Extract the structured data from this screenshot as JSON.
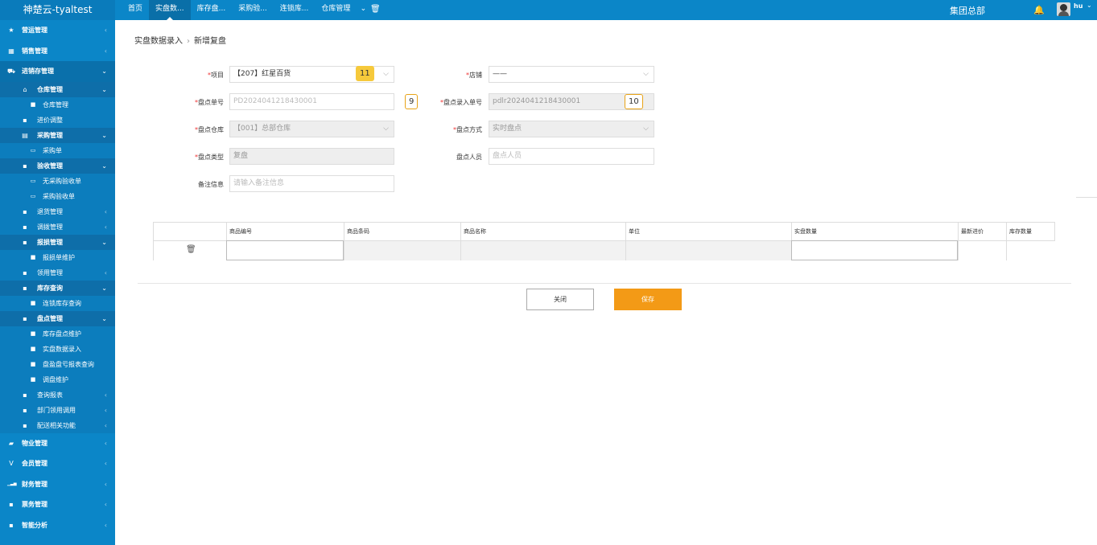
{
  "app": {
    "brand": "神楚云-tyaltest",
    "org": "集团总部",
    "user": "hu"
  },
  "topnav": [
    {
      "label": "首页",
      "active": false
    },
    {
      "label": "实盘数...",
      "active": true
    },
    {
      "label": "库存盘...",
      "active": false
    },
    {
      "label": "采购验...",
      "active": false
    },
    {
      "label": "连锁库...",
      "active": false
    },
    {
      "label": "仓库管理",
      "active": false
    }
  ],
  "topnav_more": "⌄",
  "sidebar": {
    "items": [
      {
        "label": "营运管理",
        "icon": "star-icon",
        "glyph": "★",
        "caret": "‹"
      },
      {
        "label": "销售管理",
        "icon": "chart-icon",
        "glyph": "▦",
        "caret": "‹"
      },
      {
        "label": "进销存管理",
        "icon": "truck-icon",
        "glyph": "⛟",
        "caret": "⌄"
      },
      {
        "label": "仓库管理",
        "icon": "bank-icon",
        "glyph": "⌂",
        "caret": "⌄"
      },
      {
        "label": "仓库管理",
        "icon": "square-icon",
        "glyph": "■"
      },
      {
        "label": "进价调整",
        "icon": "windows-icon",
        "glyph": "▪"
      },
      {
        "label": "采购管理",
        "icon": "file-icon",
        "glyph": "▤",
        "caret": "⌄"
      },
      {
        "label": "采购单",
        "icon": "doc-icon",
        "glyph": "▭"
      },
      {
        "label": "验收管理",
        "icon": "windows-icon",
        "glyph": "▪",
        "caret": "⌄"
      },
      {
        "label": "无采购验收单",
        "icon": "doc-icon",
        "glyph": "▭"
      },
      {
        "label": "采购验收单",
        "icon": "doc-icon",
        "glyph": "▭"
      },
      {
        "label": "退货管理",
        "icon": "windows-icon",
        "glyph": "▪",
        "caret": "‹"
      },
      {
        "label": "调拨管理",
        "icon": "windows-icon",
        "glyph": "▪",
        "caret": "‹"
      },
      {
        "label": "报损管理",
        "icon": "windows-icon",
        "glyph": "▪",
        "caret": "⌄"
      },
      {
        "label": "报损单维护",
        "icon": "square-icon",
        "glyph": "■"
      },
      {
        "label": "领用管理",
        "icon": "windows-icon",
        "glyph": "▪",
        "caret": "‹"
      },
      {
        "label": "库存查询",
        "icon": "windows-icon",
        "glyph": "▪",
        "caret": "⌄"
      },
      {
        "label": "连锁库存查询",
        "icon": "square-icon",
        "glyph": "■"
      },
      {
        "label": "盘点管理",
        "icon": "windows-icon",
        "glyph": "▪",
        "caret": "⌄"
      },
      {
        "label": "库存盘点维护",
        "icon": "square-icon",
        "glyph": "■"
      },
      {
        "label": "实盘数据录入",
        "icon": "square-icon",
        "glyph": "■"
      },
      {
        "label": "盘盈盘亏报表查询",
        "icon": "square-icon",
        "glyph": "■"
      },
      {
        "label": "调盘维护",
        "icon": "square-icon",
        "glyph": "■"
      },
      {
        "label": "查询报表",
        "icon": "windows-icon",
        "glyph": "▪",
        "caret": "‹"
      },
      {
        "label": "部门领用调用",
        "icon": "windows-icon",
        "glyph": "▪",
        "caret": "‹"
      },
      {
        "label": "配送相关功能",
        "icon": "windows-icon",
        "glyph": "▪",
        "caret": "‹"
      },
      {
        "label": "物业管理",
        "icon": "briefcase-icon",
        "glyph": "▰",
        "caret": "‹"
      },
      {
        "label": "会员管理",
        "icon": "v-icon",
        "glyph": "V",
        "caret": "‹"
      },
      {
        "label": "财务管理",
        "icon": "bars-icon",
        "glyph": "▁▃▅",
        "caret": "‹"
      },
      {
        "label": "票务管理",
        "icon": "windows-icon",
        "glyph": "▪",
        "caret": "‹"
      },
      {
        "label": "智能分析",
        "icon": "windows-icon",
        "glyph": "▪",
        "caret": "‹"
      }
    ]
  },
  "breadcrumb": {
    "parent": "实盘数据录入",
    "sep": "›",
    "current": "新增复盘"
  },
  "form": {
    "project": {
      "label": "项目",
      "value": "【207】红星百货",
      "badge": "11"
    },
    "store": {
      "label": "店铺",
      "value": "——"
    },
    "count_no": {
      "label": "盘点单号",
      "value": "PD2024041218430001",
      "badge": "9"
    },
    "entry_no": {
      "label": "盘点录入单号",
      "value": "pdlr2024041218430001",
      "badge": "10"
    },
    "warehouse": {
      "label": "盘点仓库",
      "value": "【001】总部仓库"
    },
    "method": {
      "label": "盘点方式",
      "value": "实时盘点"
    },
    "type": {
      "label": "盘点类型",
      "value": "复盘"
    },
    "person": {
      "label": "盘点人员",
      "placeholder": "盘点人员"
    },
    "remark": {
      "label": "备注信息",
      "placeholder": "请输入备注信息"
    },
    "required_mark": "*"
  },
  "grid": {
    "columns": [
      "商品编号",
      "商品条码",
      "商品名称",
      "单位",
      "实盘数量",
      "最新进价",
      "库存数量"
    ]
  },
  "buttons": {
    "close": "关闭",
    "save": "保存"
  },
  "colors": {
    "topbar": "#0b86c8",
    "sidebar": "#0b86c8",
    "primary_button": "#f39a16",
    "badge": "#f6c93b"
  }
}
